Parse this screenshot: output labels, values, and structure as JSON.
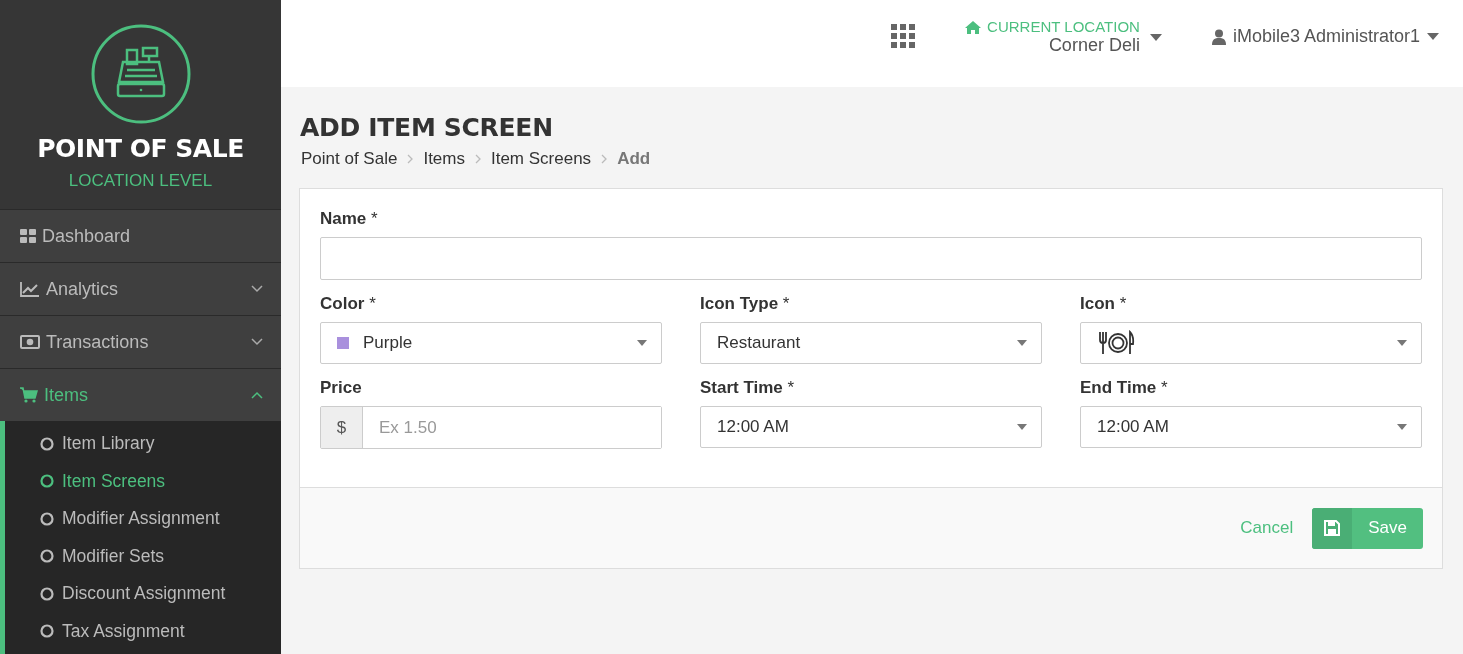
{
  "brand": {
    "title": "POINT OF SALE",
    "subtitle": "LOCATION LEVEL"
  },
  "nav": [
    {
      "label": "Dashboard",
      "selected": false
    },
    {
      "label": "Analytics",
      "expanded": false,
      "selected": false
    },
    {
      "label": "Transactions",
      "expanded": false,
      "selected": false
    },
    {
      "label": "Items",
      "expanded": true,
      "selected": true,
      "children": [
        {
          "label": "Item Library",
          "selected": false
        },
        {
          "label": "Item Screens",
          "selected": true
        },
        {
          "label": "Modifier Assignment",
          "selected": false
        },
        {
          "label": "Modifier Sets",
          "selected": false
        },
        {
          "label": "Discount Assignment",
          "selected": false
        },
        {
          "label": "Tax Assignment",
          "selected": false
        }
      ]
    }
  ],
  "header": {
    "location_label": "CURRENT LOCATION",
    "location": "Corner Deli",
    "user": "iMobile3 Administrator1"
  },
  "page_title": "ADD ITEM SCREEN",
  "breadcrumb": [
    {
      "label": "Point of Sale",
      "current": false
    },
    {
      "label": "Items",
      "current": false
    },
    {
      "label": "Item Screens",
      "current": false
    },
    {
      "label": "Add",
      "current": true
    }
  ],
  "fields": [
    {
      "kind": "text",
      "label": "Name",
      "mark": "*"
    },
    {
      "kind": "select",
      "label": "Color",
      "mark": "*",
      "value": "Purple",
      "color": "#a990dd"
    },
    {
      "kind": "select",
      "label": "Icon Type",
      "mark": "*",
      "value": "Restaurant"
    },
    {
      "kind": "icon",
      "label": "Icon",
      "mark": "*"
    },
    {
      "kind": "price",
      "label": "Price",
      "prefix": "$",
      "placeholder": "Ex 1.50"
    },
    {
      "kind": "select",
      "label": "Start Time",
      "mark": "*",
      "value": "12:00 AM"
    },
    {
      "kind": "select",
      "label": "End Time",
      "mark": "*",
      "value": "12:00 AM"
    }
  ],
  "actions": {
    "cancel": "Cancel",
    "save": "Save"
  }
}
